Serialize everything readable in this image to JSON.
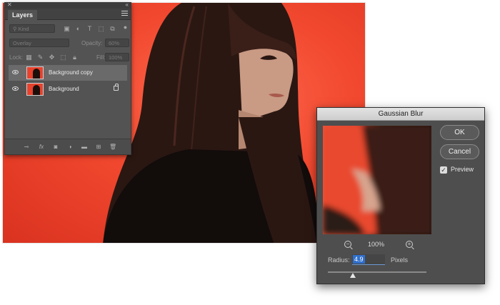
{
  "layers_panel": {
    "tab_label": "Layers",
    "filter_placeholder": "Kind",
    "blend_mode": "Overlay",
    "opacity_label": "Opacity:",
    "opacity_value": "60%",
    "lock_label": "Lock:",
    "fill_label": "Fill:",
    "fill_value": "100%",
    "layers": [
      {
        "name": "Background copy",
        "selected": true,
        "visible": true,
        "locked": false
      },
      {
        "name": "Background",
        "selected": false,
        "visible": true,
        "locked": true
      }
    ],
    "bottom_icons": [
      "link-icon",
      "fx-icon",
      "mask-icon",
      "adjustment-icon",
      "folder-icon",
      "new-layer-icon",
      "trash-icon"
    ]
  },
  "dialog": {
    "title": "Gaussian Blur",
    "ok_label": "OK",
    "cancel_label": "Cancel",
    "preview_label": "Preview",
    "preview_checked": true,
    "zoom_level": "100%",
    "radius_label": "Radius:",
    "radius_value": "4.9",
    "units_label": "Pixels",
    "slider_fraction": 0.25
  },
  "colors": {
    "panel_bg": "#535353",
    "dialog_bg": "#4e4e4e",
    "backdrop_red": "#f1482f",
    "selection_blue": "#2f6fcc"
  }
}
